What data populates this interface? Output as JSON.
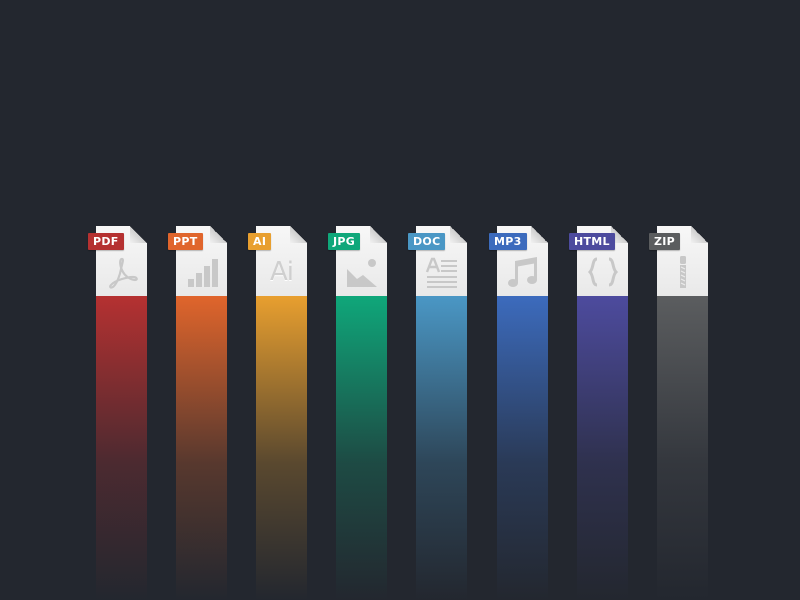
{
  "files": [
    {
      "label": "PDF",
      "icon": "acrobat-icon",
      "color": "#b53131"
    },
    {
      "label": "PPT",
      "icon": "bar-chart-icon",
      "color": "#e0652c"
    },
    {
      "label": "AI",
      "icon": "illustrator-icon",
      "color": "#e89f2f",
      "glyph_text": "Ai"
    },
    {
      "label": "JPG",
      "icon": "image-icon",
      "color": "#0fa77a"
    },
    {
      "label": "DOC",
      "icon": "text-document-icon",
      "color": "#4a97c5"
    },
    {
      "label": "MP3",
      "icon": "music-note-icon",
      "color": "#3c6bbd"
    },
    {
      "label": "HTML",
      "icon": "code-braces-icon",
      "color": "#4d4b9e"
    },
    {
      "label": "ZIP",
      "icon": "zipper-icon",
      "color": "#5b5d5f"
    }
  ]
}
